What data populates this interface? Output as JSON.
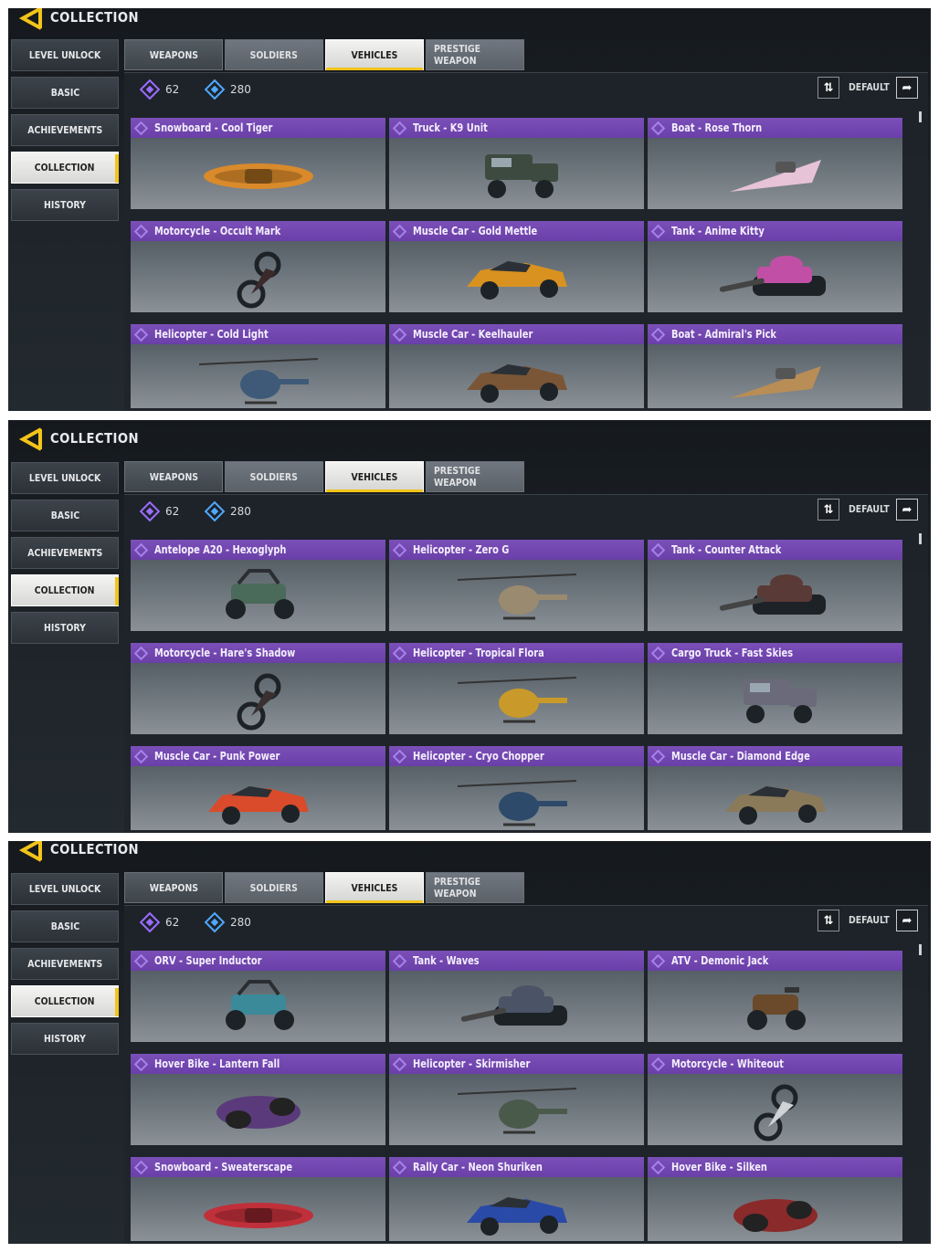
{
  "header": {
    "title": "COLLECTION"
  },
  "sidebar": {
    "items": [
      "LEVEL UNLOCK",
      "BASIC",
      "ACHIEVEMENTS",
      "COLLECTION",
      "HISTORY"
    ],
    "active_index": 3
  },
  "tabs": {
    "items": [
      "WEAPONS",
      "SOLDIERS",
      "VEHICLES",
      "PRESTIGE WEAPON"
    ],
    "active_index": 2
  },
  "currency": {
    "purple_amount": "62",
    "blue_amount": "280"
  },
  "sort": {
    "label": "DEFAULT"
  },
  "colors": {
    "accent_yellow": "#f2c419",
    "card_header_purple": "#7b4fb8",
    "background": "#1c2227"
  },
  "screens": [
    {
      "cards": [
        {
          "name": "Snowboard - Cool Tiger",
          "icon": "snowboard-icon",
          "color": "#d98a2b"
        },
        {
          "name": "Truck - K9 Unit",
          "icon": "truck-icon",
          "color": "#3d4a3f"
        },
        {
          "name": "Boat - Rose Thorn",
          "icon": "boat-icon",
          "color": "#e7c3d8"
        },
        {
          "name": "Motorcycle - Occult Mark",
          "icon": "motorcycle-icon",
          "color": "#3a2a2a"
        },
        {
          "name": "Muscle Car - Gold Mettle",
          "icon": "car-icon",
          "color": "#d9921f"
        },
        {
          "name": "Tank - Anime Kitty",
          "icon": "tank-icon",
          "color": "#c24fa6"
        },
        {
          "name": "Helicopter - Cold Light",
          "icon": "helicopter-icon",
          "color": "#3e5a78"
        },
        {
          "name": "Muscle Car - Keelhauler",
          "icon": "car-icon",
          "color": "#7a5636"
        },
        {
          "name": "Boat - Admiral's Pick",
          "icon": "boat-icon",
          "color": "#b98d56"
        }
      ]
    },
    {
      "cards": [
        {
          "name": "Antelope A20 - Hexoglyph",
          "icon": "buggy-icon",
          "color": "#4a6a5a"
        },
        {
          "name": "Helicopter - Zero G",
          "icon": "helicopter-icon",
          "color": "#9a8a70"
        },
        {
          "name": "Tank - Counter Attack",
          "icon": "tank-icon",
          "color": "#5a3a36"
        },
        {
          "name": "Motorcycle - Hare's Shadow",
          "icon": "motorcycle-icon",
          "color": "#3a3030"
        },
        {
          "name": "Helicopter - Tropical Flora",
          "icon": "helicopter-icon",
          "color": "#c99a2a"
        },
        {
          "name": "Cargo Truck - Fast Skies",
          "icon": "truck-icon",
          "color": "#6a6a7a"
        },
        {
          "name": "Muscle Car - Punk Power",
          "icon": "car-icon",
          "color": "#d94b2a"
        },
        {
          "name": "Helicopter - Cryo Chopper",
          "icon": "helicopter-icon",
          "color": "#2e4a6a"
        },
        {
          "name": "Muscle Car - Diamond Edge",
          "icon": "car-icon",
          "color": "#8a7a5a"
        }
      ]
    },
    {
      "cards": [
        {
          "name": "ORV - Super Inductor",
          "icon": "buggy-icon",
          "color": "#3a8a9a"
        },
        {
          "name": "Tank - Waves",
          "icon": "tank-icon",
          "color": "#4a5466"
        },
        {
          "name": "ATV - Demonic Jack",
          "icon": "atv-icon",
          "color": "#6a4a2a"
        },
        {
          "name": "Hover Bike - Lantern Fall",
          "icon": "hoverbike-icon",
          "color": "#5a3a7a"
        },
        {
          "name": "Helicopter - Skirmisher",
          "icon": "helicopter-icon",
          "color": "#4a5a4a"
        },
        {
          "name": "Motorcycle - Whiteout",
          "icon": "motorcycle-icon",
          "color": "#cfd2d6"
        },
        {
          "name": "Snowboard - Sweaterscape",
          "icon": "snowboard-icon",
          "color": "#c0303a"
        },
        {
          "name": "Rally Car - Neon Shuriken",
          "icon": "car-icon",
          "color": "#2a4aa8"
        },
        {
          "name": "Hover Bike - Silken",
          "icon": "hoverbike-icon",
          "color": "#8a2a2a"
        }
      ]
    }
  ]
}
